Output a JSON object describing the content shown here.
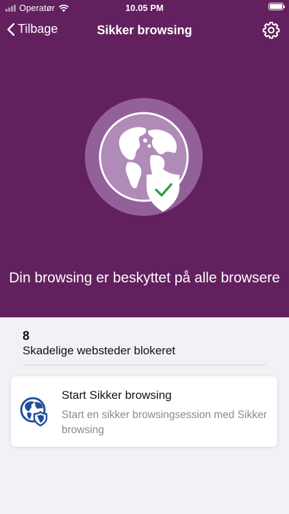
{
  "status_bar": {
    "carrier": "Operatør",
    "time": "10.05 PM"
  },
  "nav": {
    "back_label": "Tilbage",
    "title": "Sikker browsing",
    "settings_icon": "gear-icon"
  },
  "hero": {
    "icon": "globe-shield-check-icon",
    "message": "Din browsing er beskyttet på alle browsere"
  },
  "stats": {
    "blocked_count": "8",
    "blocked_label": "Skadelige websteder blokeret"
  },
  "card": {
    "icon": "globe-shield-icon",
    "title": "Start Sikker browsing",
    "description": "Start en sikker browsingsession med Sikker browsing"
  },
  "colors": {
    "hero_background": "#62205f",
    "check_green": "#2e9e44",
    "icon_blue": "#1f4e9a",
    "page_background": "#f2f1f5"
  }
}
